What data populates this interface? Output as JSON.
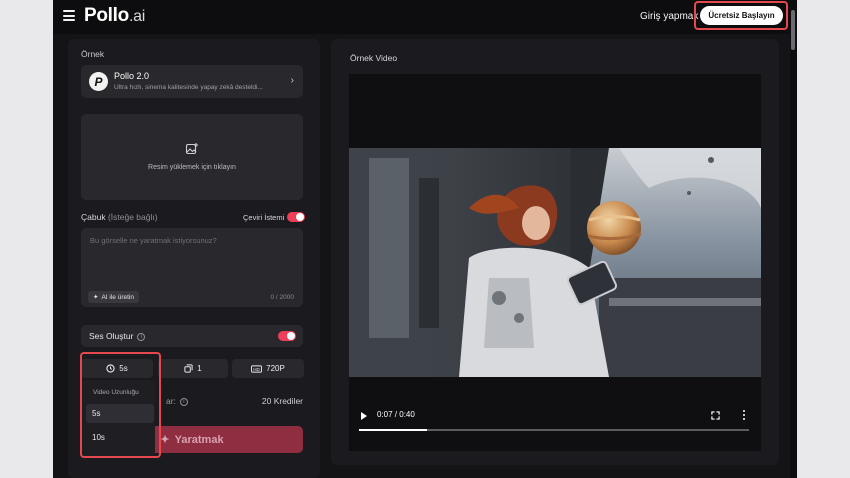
{
  "header": {
    "logo_main": "Pollo",
    "logo_suffix": ".ai",
    "login_label": "Giriş yapmak",
    "cta_label": "Ücretsiz Başlayın"
  },
  "left_panel": {
    "section_label": "Örnek",
    "model": {
      "logo_letter": "P",
      "name": "Pollo 2.0",
      "description": "Ultra hızlı, sinema kalitesinde yapay zekâ desteldi..."
    },
    "upload": {
      "text": "Resim yüklemek için tıklayın"
    },
    "prompt": {
      "label": "Çabuk",
      "optional": "(İsteğe bağlı)",
      "translate_label": "Çeviri İstemi",
      "translate_on": true,
      "placeholder": "Bu görselle ne yaratmak istiyorsunuz?",
      "ai_button": "AI ile üretin",
      "counter": "0 / 2000"
    },
    "audio": {
      "label": "Ses Oluştur",
      "enabled": true
    },
    "options": {
      "duration": "5s",
      "count": "1",
      "resolution": "720P"
    },
    "credits": {
      "lead": "ar:",
      "value": "20 Krediler"
    },
    "create_button": "Yaratmak",
    "duration_dropdown": {
      "title": "Video Uzunluğu",
      "options": [
        "5s",
        "10s"
      ],
      "selected": "5s"
    }
  },
  "right_panel": {
    "title": "Örnek Video",
    "player": {
      "time": "0:07 / 0:40",
      "progress": 0.175
    }
  },
  "colors": {
    "accent": "#f03e58",
    "highlight": "#e5484d",
    "panel": "#1b1b1f",
    "card": "#28282d"
  }
}
